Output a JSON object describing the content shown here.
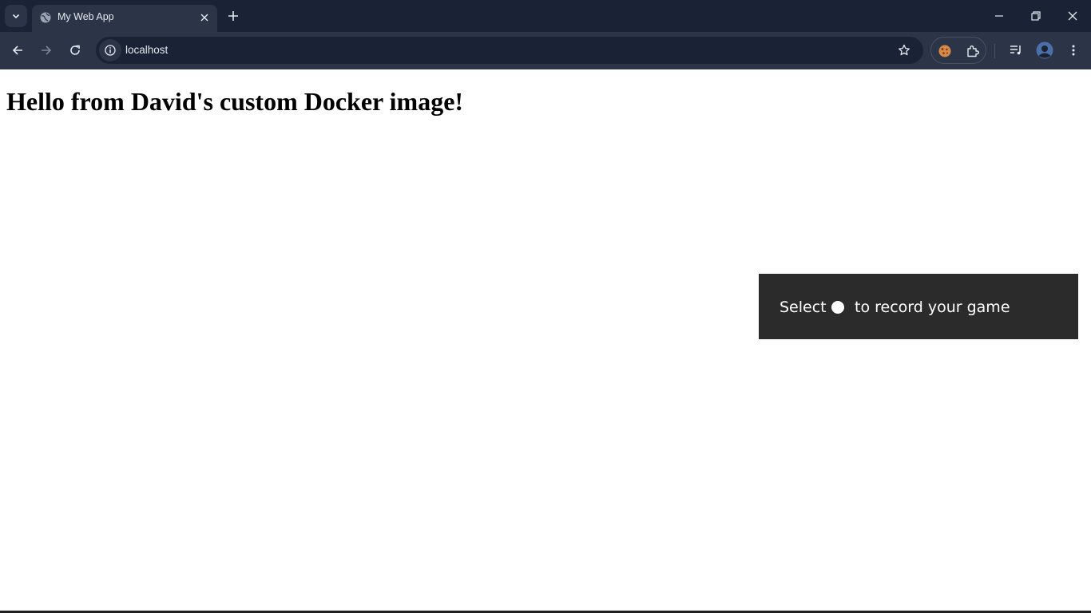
{
  "browser": {
    "tab": {
      "title": "My Web App"
    },
    "address_bar": {
      "url": "localhost"
    },
    "colors": {
      "frame": "#1a2335",
      "toolbar": "#2c3547",
      "text": "#e6e9ef"
    }
  },
  "page": {
    "heading": "Hello from David's custom Docker image!"
  },
  "toast": {
    "text_before": "Select",
    "text_after": "to record your game",
    "icon": "record-dot-icon",
    "background": "#2b2b2b"
  }
}
